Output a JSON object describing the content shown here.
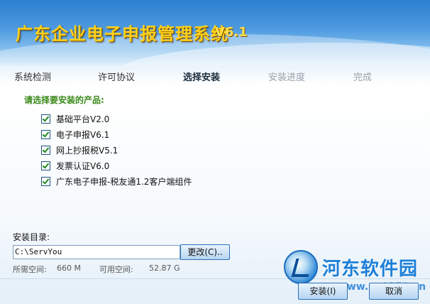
{
  "header": {
    "title": "广东企业电子申报管理系统",
    "version": "V6.1"
  },
  "steps": [
    {
      "label": "系统检测",
      "state": "done"
    },
    {
      "label": "许可协议",
      "state": "done"
    },
    {
      "label": "选择安装",
      "state": "active"
    },
    {
      "label": "安装进度",
      "state": "future"
    },
    {
      "label": "完成",
      "state": "future"
    }
  ],
  "products": {
    "section_label": "请选择要安装的产品:",
    "items": [
      {
        "label": "基础平台V2.0",
        "checked": true
      },
      {
        "label": "电子申报V6.1",
        "checked": true
      },
      {
        "label": "网上抄报税V5.1",
        "checked": true
      },
      {
        "label": "发票认证V6.0",
        "checked": true
      },
      {
        "label": "广东电子申报-税友通1.2客户端组件",
        "checked": true
      }
    ]
  },
  "install_dir": {
    "label": "安装目录:",
    "value": "C:\\ServYou",
    "change_button": "更改(C)..",
    "required_label": "所需空间:",
    "required_value": "660 M",
    "available_label": "可用空间:",
    "available_value": "52.87 G"
  },
  "watermark": {
    "text": "河东软件园",
    "url": "www.pc0359.cn"
  },
  "footer": {
    "install_button": "安装(I)",
    "cancel_button": "取消"
  },
  "colors": {
    "accent": "#3a8a1a",
    "title": "#ffd21a",
    "header_blue": "#2a7fd0"
  }
}
